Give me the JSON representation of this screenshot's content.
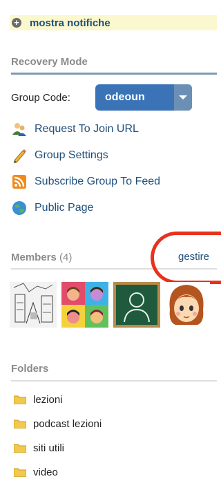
{
  "notifications": {
    "label": "mostra notifiche"
  },
  "recovery": {
    "title": "Recovery Mode"
  },
  "group_code": {
    "label": "Group Code:",
    "value": "odeoun"
  },
  "links": [
    {
      "label": "Request To Join URL",
      "icon": "request-join-icon"
    },
    {
      "label": "Group Settings",
      "icon": "pencil-icon"
    },
    {
      "label": "Subscribe Group To Feed",
      "icon": "rss-feed-icon"
    },
    {
      "label": "Public Page",
      "icon": "globe-icon"
    }
  ],
  "members": {
    "title": "Members",
    "count": "(4)",
    "manage_label": "gestire"
  },
  "folders": {
    "title": "Folders",
    "items": [
      {
        "label": "lezioni"
      },
      {
        "label": "podcast lezioni"
      },
      {
        "label": "siti utili"
      },
      {
        "label": "video"
      }
    ]
  },
  "colors": {
    "link": "#1f4e7a",
    "select": "#3a74b6",
    "highlight": "#e8321d",
    "notice": "#fbf8cf"
  }
}
